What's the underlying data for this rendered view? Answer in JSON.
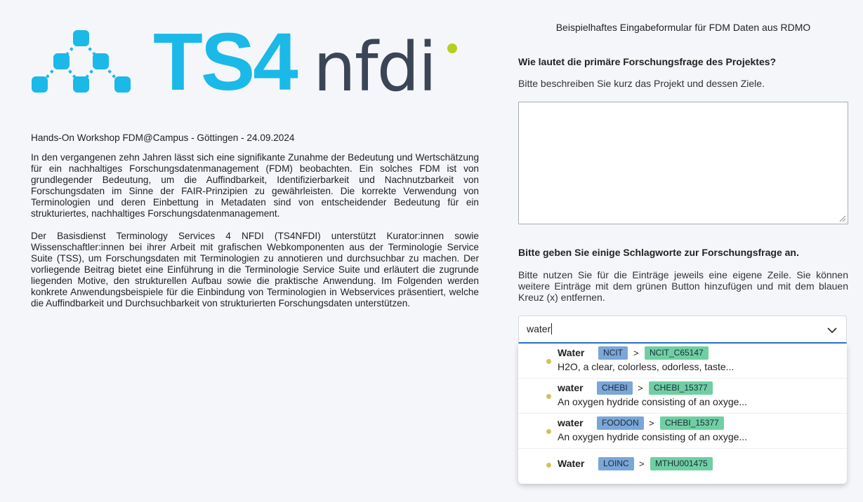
{
  "logo": {
    "icon": "ts4-network-icon",
    "text_ts4": "TS4",
    "text_nfdi": "nfdi",
    "colors": {
      "ts4": "#1ab9e8",
      "nfdi": "#3b4556",
      "dot": "#b6cf1d"
    }
  },
  "intro": {
    "heading": "Hands-On Workshop FDM@Campus - Göttingen - 24.09.2024",
    "paragraph1": "In den vergangenen zehn Jahren lässt sich eine signifikante Zunahme der Bedeutung und Wertschätzung für ein nachhaltiges Forschungsdatenmanagement (FDM) beobachten. Ein solches FDM ist von grundlegender Bedeutung, um die Auffindbarkeit, Identifizierbarkeit und Nachnutzbarkeit von Forschungsdaten im Sinne der FAIR-Prinzipien zu gewährleisten. Die korrekte Verwendung von Terminologien und deren Einbettung in Metadaten sind von entscheidender Bedeutung für ein strukturiertes, nachhaltiges Forschungsdatenmanagement.",
    "paragraph2": "Der Basisdienst Terminology Services 4 NFDI (TS4NFDI) unterstützt Kurator:innen sowie Wissenschaftler:innen bei ihrer Arbeit mit grafischen Webkomponenten aus der Terminologie Service Suite (TSS), um Forschungsdaten mit Terminologien zu annotieren und durchsuchbar zu machen. Der vorliegende Beitrag bietet eine Einführung in die Terminologie Service Suite und erläutert die zugrunde liegenden Motive, den strukturellen Aufbau sowie die praktische Anwendung. Im Folgenden werden konkrete Anwendungsbeispiele für die Einbindung von Terminologien in Webservices präsentiert, welche die Auffindbarkeit und Durchsuchbarkeit von strukturierten Forschungsdaten unterstützen."
  },
  "form": {
    "title": "Beispielhaftes Eingabeformular für FDM Daten aus RDMO",
    "q1": {
      "label": "Wie lautet die primäre Forschungsfrage des Projektes?",
      "help": "Bitte beschreiben Sie kurz das Projekt und dessen Ziele.",
      "value": ""
    },
    "q2": {
      "label": "Bitte geben Sie einige Schlagworte zur Forschungsfrage an.",
      "help": "Bitte nutzen Sie für die Einträge jeweils eine eigene Zeile. Sie können weitere Einträge mit dem grünen Button hinzufügen und mit dem blauen Kreuz (x) entfernen.",
      "search_value": "water",
      "options": [
        {
          "label": "Water",
          "ontology": "NCIT",
          "separator": ">",
          "term_id": "NCIT_C65147",
          "description": "H2O, a clear, colorless, odorless, taste..."
        },
        {
          "label": "water",
          "ontology": "CHEBI",
          "separator": ">",
          "term_id": "CHEBI_15377",
          "description": "An oxygen hydride consisting of an oxyge..."
        },
        {
          "label": "water",
          "ontology": "FOODON",
          "separator": ">",
          "term_id": "CHEBI_15377",
          "description": "An oxygen hydride consisting of an oxyge..."
        },
        {
          "label": "Water",
          "ontology": "LOINC",
          "separator": ">",
          "term_id": "MTHU001475",
          "description": ""
        }
      ]
    }
  },
  "colors": {
    "background": "#f5f6fa",
    "ontology_badge": "#7aa6d8",
    "term_badge": "#6fcfa3",
    "focus_border": "#2a73c9",
    "bullet": "#cfc25a"
  }
}
